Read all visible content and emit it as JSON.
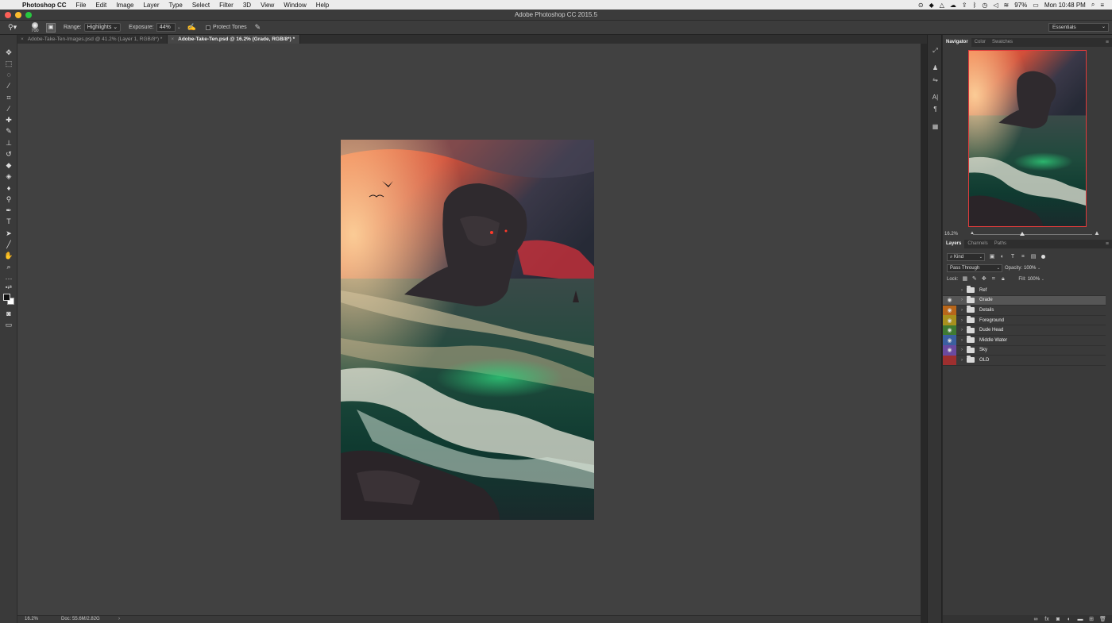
{
  "menubar": {
    "apple": "",
    "items": [
      "Photoshop CC",
      "File",
      "Edit",
      "Image",
      "Layer",
      "Type",
      "Select",
      "Filter",
      "3D",
      "View",
      "Window",
      "Help"
    ],
    "status": {
      "battery": "97%",
      "clock": "Mon 10:48 PM"
    }
  },
  "window": {
    "title": "Adobe Photoshop CC 2015.5"
  },
  "options": {
    "brush_size": "700",
    "range_label": "Range:",
    "range_value": "Highlights",
    "exposure_label": "Exposure:",
    "exposure_value": "44%",
    "protect_tones": "Protect Tones",
    "workspace": "Essentials"
  },
  "tabs": [
    {
      "label": "Adobe-Take-Ten-Images.psd @ 41.2% (Layer 1, RGB/8*) *",
      "active": false
    },
    {
      "label": "Adobe-Take-Ten.psd @ 16.2% (Grade, RGB/8*) *",
      "active": true
    }
  ],
  "status": {
    "zoom": "16.2%",
    "doc": "Doc: 55.6M/2.82G",
    "arrow": "›"
  },
  "panels": {
    "top_tabs": [
      "Navigator",
      "Color",
      "Swatches"
    ],
    "navigator_zoom": "16.2%",
    "layer_tabs": [
      "Layers",
      "Channels",
      "Paths"
    ],
    "filter_kind": "Kind",
    "blend_mode": "Pass Through",
    "opacity_label": "Opacity:",
    "opacity_value": "100%",
    "lock_label": "Lock:",
    "fill_label": "Fill:",
    "fill_value": "100%"
  },
  "layers": [
    {
      "name": "Ref",
      "visible": false,
      "color": ""
    },
    {
      "name": "Grade",
      "visible": true,
      "color": "",
      "selected": true
    },
    {
      "name": "Details",
      "visible": true,
      "color": "#b8661a"
    },
    {
      "name": "Foreground",
      "visible": true,
      "color": "#a8901e"
    },
    {
      "name": "Dude Head",
      "visible": true,
      "color": "#3f7a32"
    },
    {
      "name": "Middle Water",
      "visible": true,
      "color": "#3b5fa0"
    },
    {
      "name": "Sky",
      "visible": true,
      "color": "#6a4aa0"
    },
    {
      "name": "OLD",
      "visible": false,
      "color": "#9e2f2f"
    }
  ]
}
